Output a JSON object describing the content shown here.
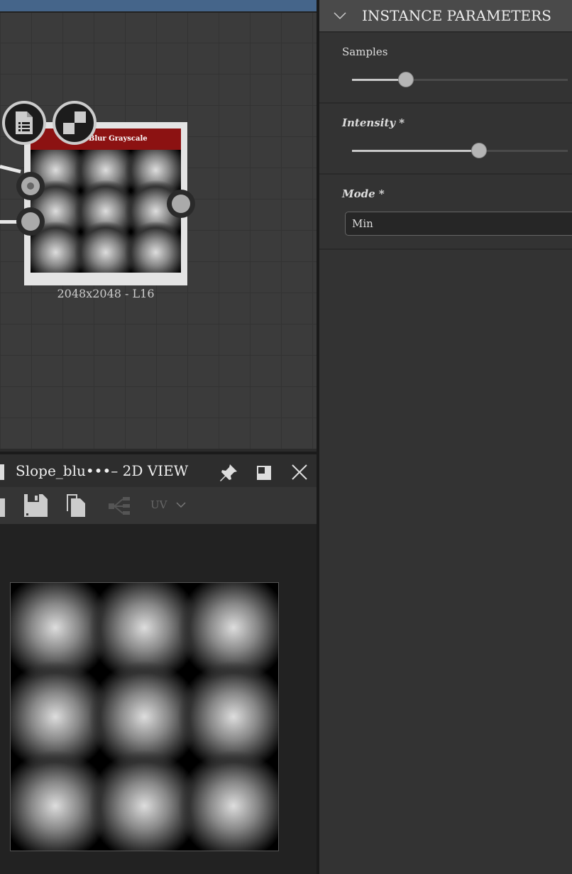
{
  "graph": {
    "node": {
      "title": "Slope Blur Grayscale",
      "resolution": "2048x2048 - L16",
      "header_color": "#8c1212"
    }
  },
  "view2d": {
    "title": "Slope_blu•••– 2D VIEW",
    "toolbar": {
      "uv_label": "UV"
    }
  },
  "panel": {
    "title": "INSTANCE PARAMETERS",
    "params": [
      {
        "label": "Samples",
        "type": "slider",
        "value_fraction": 0.25
      },
      {
        "label": "Intensity *",
        "type": "slider",
        "value_fraction": 0.59
      },
      {
        "label": "Mode *",
        "type": "select",
        "value": "Min"
      }
    ]
  }
}
